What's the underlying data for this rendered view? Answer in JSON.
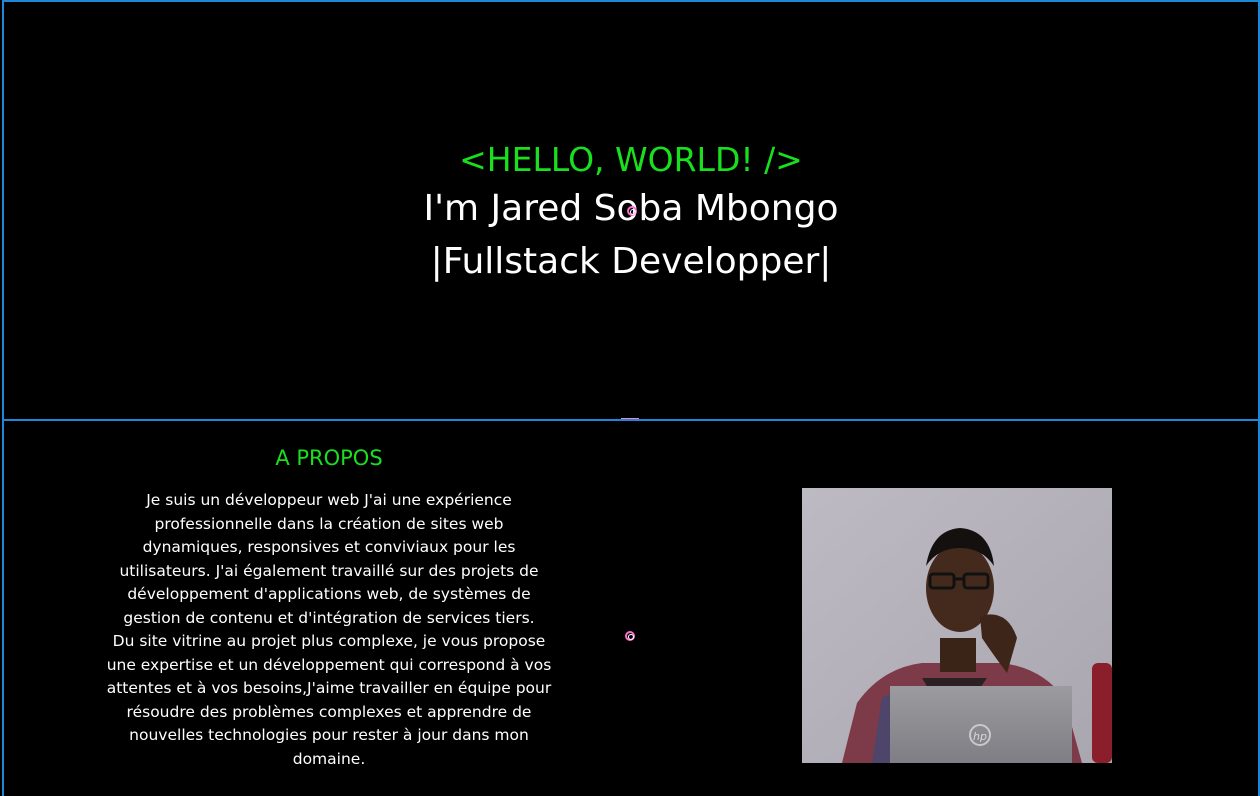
{
  "hero": {
    "greeting": "<HELLO, WORLD! />",
    "name": "I'm Jared Soba Mbongo",
    "role": "|Fullstack Developper|"
  },
  "about": {
    "title": "A PROPOS",
    "paragraph_lines": [
      "Je suis un développeur web J'ai une expérience",
      "professionnelle dans la création de sites web",
      "dynamiques, responsives et conviviaux pour les",
      "utilisateurs. J'ai également travaillé sur des projets de",
      "développement d'applications web, de systèmes de",
      "gestion de contenu et d'intégration de services tiers.",
      "Du site vitrine au projet plus complexe, je vous propose",
      "une expertise et un développement qui correspond à vos",
      "attentes et à vos besoins,J'aime travailler en équipe pour",
      "résoudre des problèmes complexes et apprendre de",
      "nouvelles technologies pour rester à jour dans mon",
      "domaine."
    ],
    "laptop_logo": "hp"
  },
  "colors": {
    "accent": "#19e01e",
    "background": "#000000",
    "border": "#1e88d6",
    "cursor": "#ff6fcf"
  }
}
